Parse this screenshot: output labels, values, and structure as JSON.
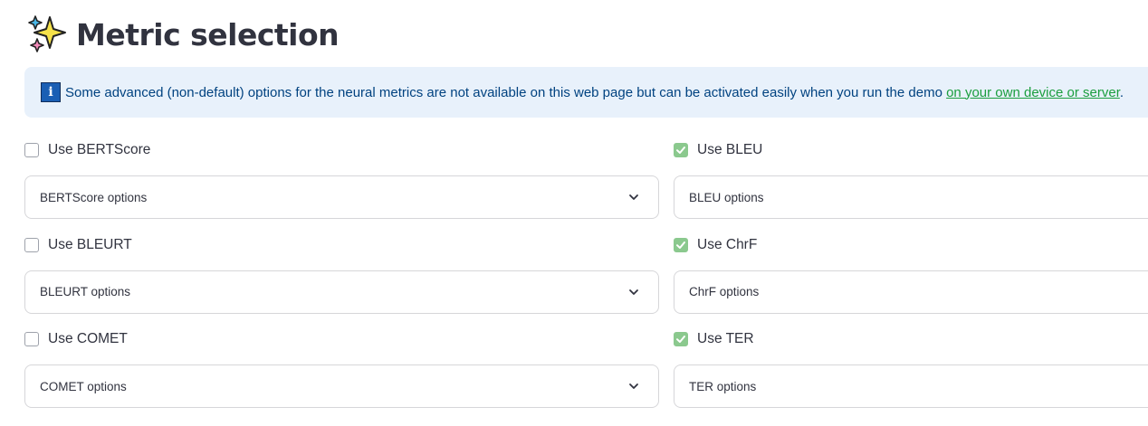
{
  "header": {
    "icon": "sparkles-icon",
    "title": "Metric selection"
  },
  "info": {
    "icon": "information-icon",
    "icon_glyph": "i",
    "text": "Some advanced (non-default) options for the neural metrics are not available on this web page but can be activated easily when you run the demo ",
    "link_text": "on your own device or server",
    "suffix": "."
  },
  "colors": {
    "accent_checked": "#8bc98e",
    "info_bg": "#e8f1fb",
    "link": "#1b9e3e"
  },
  "left_metrics": [
    {
      "label": "Use BERTScore",
      "checked": false,
      "options_label": "BERTScore options",
      "expander_icon": "chevron-down-icon"
    },
    {
      "label": "Use BLEURT",
      "checked": false,
      "options_label": "BLEURT options",
      "expander_icon": "chevron-down-icon"
    },
    {
      "label": "Use COMET",
      "checked": false,
      "options_label": "COMET options",
      "expander_icon": "chevron-down-icon"
    }
  ],
  "right_metrics": [
    {
      "label": "Use BLEU",
      "checked": true,
      "options_label": "BLEU options",
      "expander_icon": "chevron-down-icon"
    },
    {
      "label": "Use ChrF",
      "checked": true,
      "options_label": "ChrF options",
      "expander_icon": "chevron-down-icon"
    },
    {
      "label": "Use TER",
      "checked": true,
      "options_label": "TER options",
      "expander_icon": "chevron-down-icon"
    }
  ]
}
